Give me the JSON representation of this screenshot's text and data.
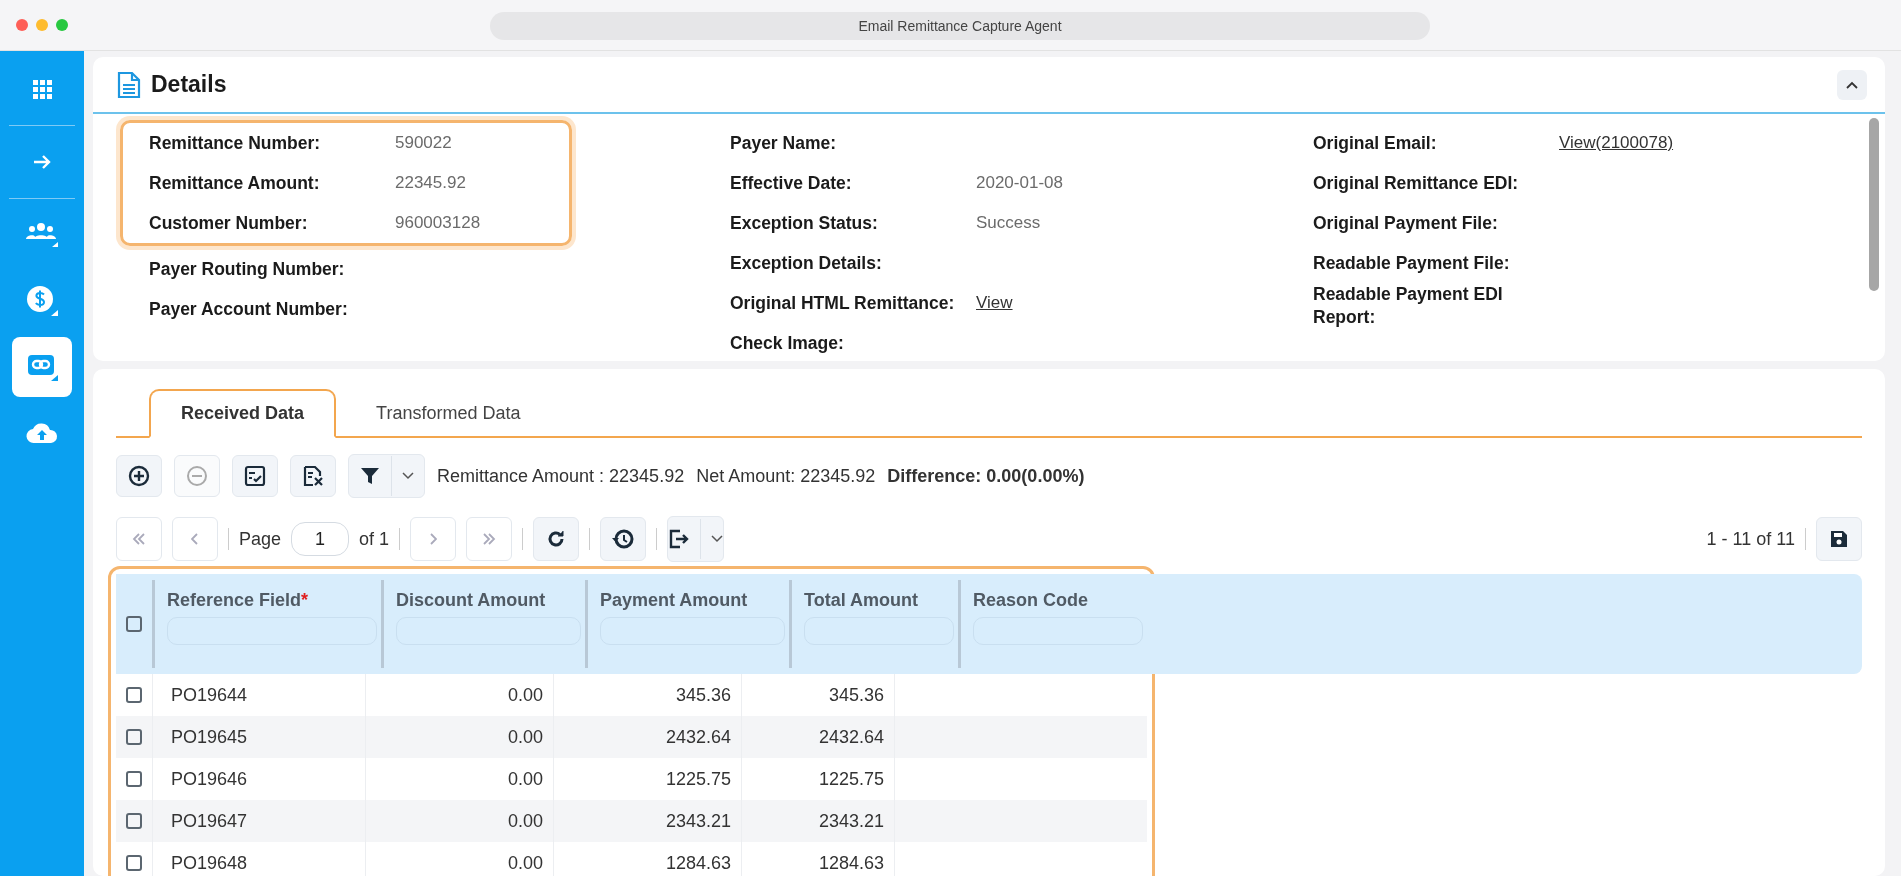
{
  "window": {
    "title": "Email Remittance Capture Agent"
  },
  "sidebar": {
    "items": [
      {
        "kind": "apps",
        "selected": false
      },
      {
        "kind": "arrow",
        "selected": false
      },
      {
        "kind": "people",
        "selected": false
      },
      {
        "kind": "dollar",
        "selected": false
      },
      {
        "kind": "link",
        "selected": true
      },
      {
        "kind": "upload",
        "selected": false
      }
    ]
  },
  "details": {
    "title": "Details",
    "columns": [
      [
        {
          "highlighted": true,
          "fields": [
            {
              "label": "Remittance Number:",
              "value": "590022",
              "kind": "text"
            },
            {
              "label": "Remittance Amount:",
              "value": "22345.92",
              "kind": "text"
            },
            {
              "label": "Customer Number:",
              "value": "960003128",
              "kind": "text"
            }
          ]
        },
        {
          "highlighted": false,
          "fields": [
            {
              "label": "Payer Routing Number:"
            },
            {
              "label": "Payer Account Number:"
            }
          ]
        }
      ],
      [
        {
          "highlighted": false,
          "fields": [
            {
              "label": "Payer Name:"
            },
            {
              "label": "Effective Date:",
              "value": "2020-01-08",
              "kind": "text"
            },
            {
              "label": "Exception Status:",
              "value": "Success",
              "kind": "text"
            },
            {
              "label": "Exception Details:"
            },
            {
              "label": "Original HTML Remittance:",
              "value": "View",
              "kind": "link"
            },
            {
              "label": "Check Image:"
            }
          ]
        }
      ],
      [
        {
          "highlighted": false,
          "fields": [
            {
              "label": "Original Email:",
              "value": "View(2100078)",
              "kind": "link"
            },
            {
              "label": "Original Remittance EDI:"
            },
            {
              "label": "Original Payment File:"
            },
            {
              "label": "Readable Payment File:"
            },
            {
              "label": "Readable Payment EDI Report:"
            }
          ]
        }
      ]
    ]
  },
  "tabs": [
    {
      "label": "Received Data",
      "selected": true
    },
    {
      "label": "Transformed Data",
      "selected": false
    }
  ],
  "toolbar": {
    "buttons": [
      {
        "kind": "add",
        "disabled": false
      },
      {
        "kind": "remove",
        "disabled": true
      },
      {
        "kind": "checklist",
        "disabled": false
      },
      {
        "kind": "excel",
        "disabled": false
      },
      {
        "kind": "filter",
        "disabled": false
      }
    ],
    "summary": [
      {
        "text": "Remittance Amount : 22345.92",
        "bold": false
      },
      {
        "text": "Net Amount: 22345.92",
        "bold": false
      },
      {
        "text": "Difference: 0.00(0.00%)",
        "bold": true
      }
    ]
  },
  "pager": {
    "first_disabled": true,
    "prev_disabled": true,
    "page_label": "Page",
    "page": "1",
    "of": "of 1",
    "next_disabled": true,
    "last_disabled": true,
    "range": "1 - 11 of 11"
  },
  "table": {
    "highlighted": true,
    "header_checked": false,
    "columns": [
      {
        "label": "Reference Field",
        "required_mark": "*",
        "kind": "text"
      },
      {
        "label": "Discount Amount",
        "kind": "amount"
      },
      {
        "label": "Payment Amount",
        "kind": "amount"
      },
      {
        "label": "Total Amount",
        "kind": "amount"
      },
      {
        "label": "Reason Code",
        "kind": "text"
      }
    ],
    "rows": [
      {
        "checked": false,
        "cells": [
          "PO19644",
          "0.00",
          "345.36",
          "345.36",
          ""
        ]
      },
      {
        "checked": false,
        "cells": [
          "PO19645",
          "0.00",
          "2432.64",
          "2432.64",
          ""
        ]
      },
      {
        "checked": false,
        "cells": [
          "PO19646",
          "0.00",
          "1225.75",
          "1225.75",
          ""
        ]
      },
      {
        "checked": false,
        "cells": [
          "PO19647",
          "0.00",
          "2343.21",
          "2343.21",
          ""
        ]
      },
      {
        "checked": false,
        "cells": [
          "PO19648",
          "0.00",
          "1284.63",
          "1284.63",
          ""
        ]
      }
    ]
  }
}
